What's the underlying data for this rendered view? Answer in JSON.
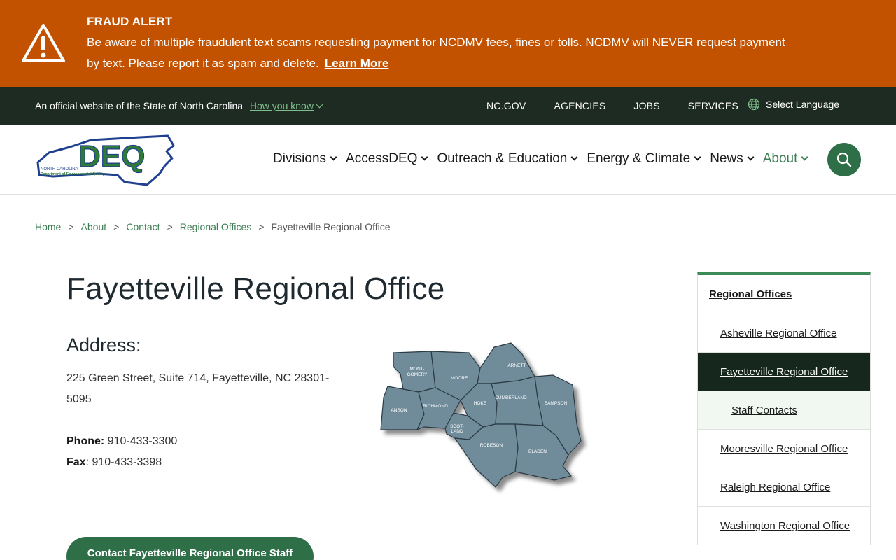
{
  "alert": {
    "title": "FRAUD ALERT",
    "text": "Be aware of multiple fraudulent text scams requesting payment for NCDMV fees, fines or tolls. NCDMV will NEVER request payment by text. Please report it as spam and delete.",
    "link": "Learn More",
    "icon": "warning-icon"
  },
  "govbar": {
    "official": "An official website of the State of North Carolina",
    "how_know": "How you know",
    "nav": [
      "NC.GOV",
      "AGENCIES",
      "JOBS",
      "SERVICES"
    ],
    "language": "Select Language"
  },
  "header": {
    "logo_text": "DEQ",
    "logo_sub1": "NORTH CAROLINA",
    "logo_sub2": "Department of Environmental Quality",
    "nav": [
      "Divisions",
      "AccessDEQ",
      "Outreach & Education",
      "Energy & Climate",
      "News",
      "About"
    ],
    "active_nav": "About"
  },
  "breadcrumb": {
    "items": [
      "Home",
      "About",
      "Contact",
      "Regional Offices"
    ],
    "current": "Fayetteville Regional Office"
  },
  "main": {
    "title": "Fayetteville Regional Office",
    "address_heading": "Address:",
    "address": "225 Green Street, Suite 714, Fayetteville, NC 28301-5095",
    "phone_label": "Phone:",
    "phone": " 910-433-3300",
    "fax_label": "Fax",
    "fax": ": 910-433-3398",
    "contact_button": "Contact Fayetteville Regional Office Staff",
    "map_counties": [
      "MONT-",
      "GOMERY",
      "MOORE",
      "HARNETT",
      "ANSON",
      "RICHMOND",
      "HOKE",
      "CUMBERLAND",
      "SAMPSON",
      "SCOT-",
      "LAND",
      "ROBESON",
      "BLADEN"
    ]
  },
  "sidebar": {
    "heading": "Regional Offices",
    "items": [
      {
        "label": "Asheville Regional Office",
        "level": 1
      },
      {
        "label": "Fayetteville Regional Office",
        "level": 1,
        "active": true
      },
      {
        "label": "Staff Contacts",
        "level": 2
      },
      {
        "label": "Mooresville Regional Office",
        "level": 1
      },
      {
        "label": "Raleigh Regional Office",
        "level": 1
      },
      {
        "label": "Washington Regional Office",
        "level": 1
      }
    ]
  },
  "colors": {
    "alert_bg": "#c35200",
    "govbar_bg": "#1d2b22",
    "brand_green": "#2f6f48",
    "link_green": "#3b7d52",
    "sidebar_active": "#16281e",
    "map_fill": "#6f8c9b"
  }
}
